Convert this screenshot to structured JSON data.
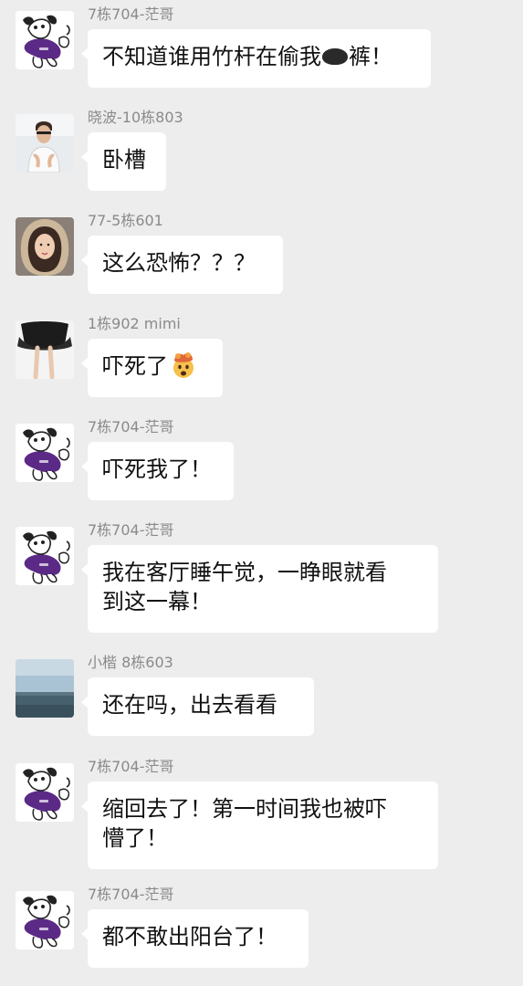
{
  "messages": [
    {
      "sender": "7栋704-茫哥",
      "avatar": "cartoon-dog-avatar",
      "text_before": "不知道谁用竹杆在偷我",
      "redacted": true,
      "text_after": "裤！"
    },
    {
      "sender": "晓波-10栋803",
      "avatar": "man-photo-avatar",
      "text": "卧槽"
    },
    {
      "sender": "77-5栋601",
      "avatar": "woman-hood-avatar",
      "text": "这么恐怖？？？"
    },
    {
      "sender": "1栋902 mimi",
      "avatar": "legs-photo-avatar",
      "text": "吓死了",
      "emoji": "exploding-head-emoji"
    },
    {
      "sender": "7栋704-茫哥",
      "avatar": "cartoon-dog-avatar",
      "text": "吓死我了！"
    },
    {
      "sender": "7栋704-茫哥",
      "avatar": "cartoon-dog-avatar",
      "line1": "我在客厅睡午觉，一睁眼就看",
      "line2": "到这一幕！"
    },
    {
      "sender": "小楷 8栋603",
      "avatar": "seascape-avatar",
      "text": "还在吗，出去看看"
    },
    {
      "sender": "7栋704-茫哥",
      "avatar": "cartoon-dog-avatar",
      "line1": "缩回去了！第一时间我也被吓",
      "line2": "懵了！"
    },
    {
      "sender": "7栋704-茫哥",
      "avatar": "cartoon-dog-avatar",
      "text": "都不敢出阳台了！"
    }
  ],
  "colors": {
    "background": "#ededed",
    "bubble": "#ffffff",
    "sender_text": "#8a8a8a",
    "message_text": "#111111",
    "dog_purple": "#5b2a86"
  }
}
